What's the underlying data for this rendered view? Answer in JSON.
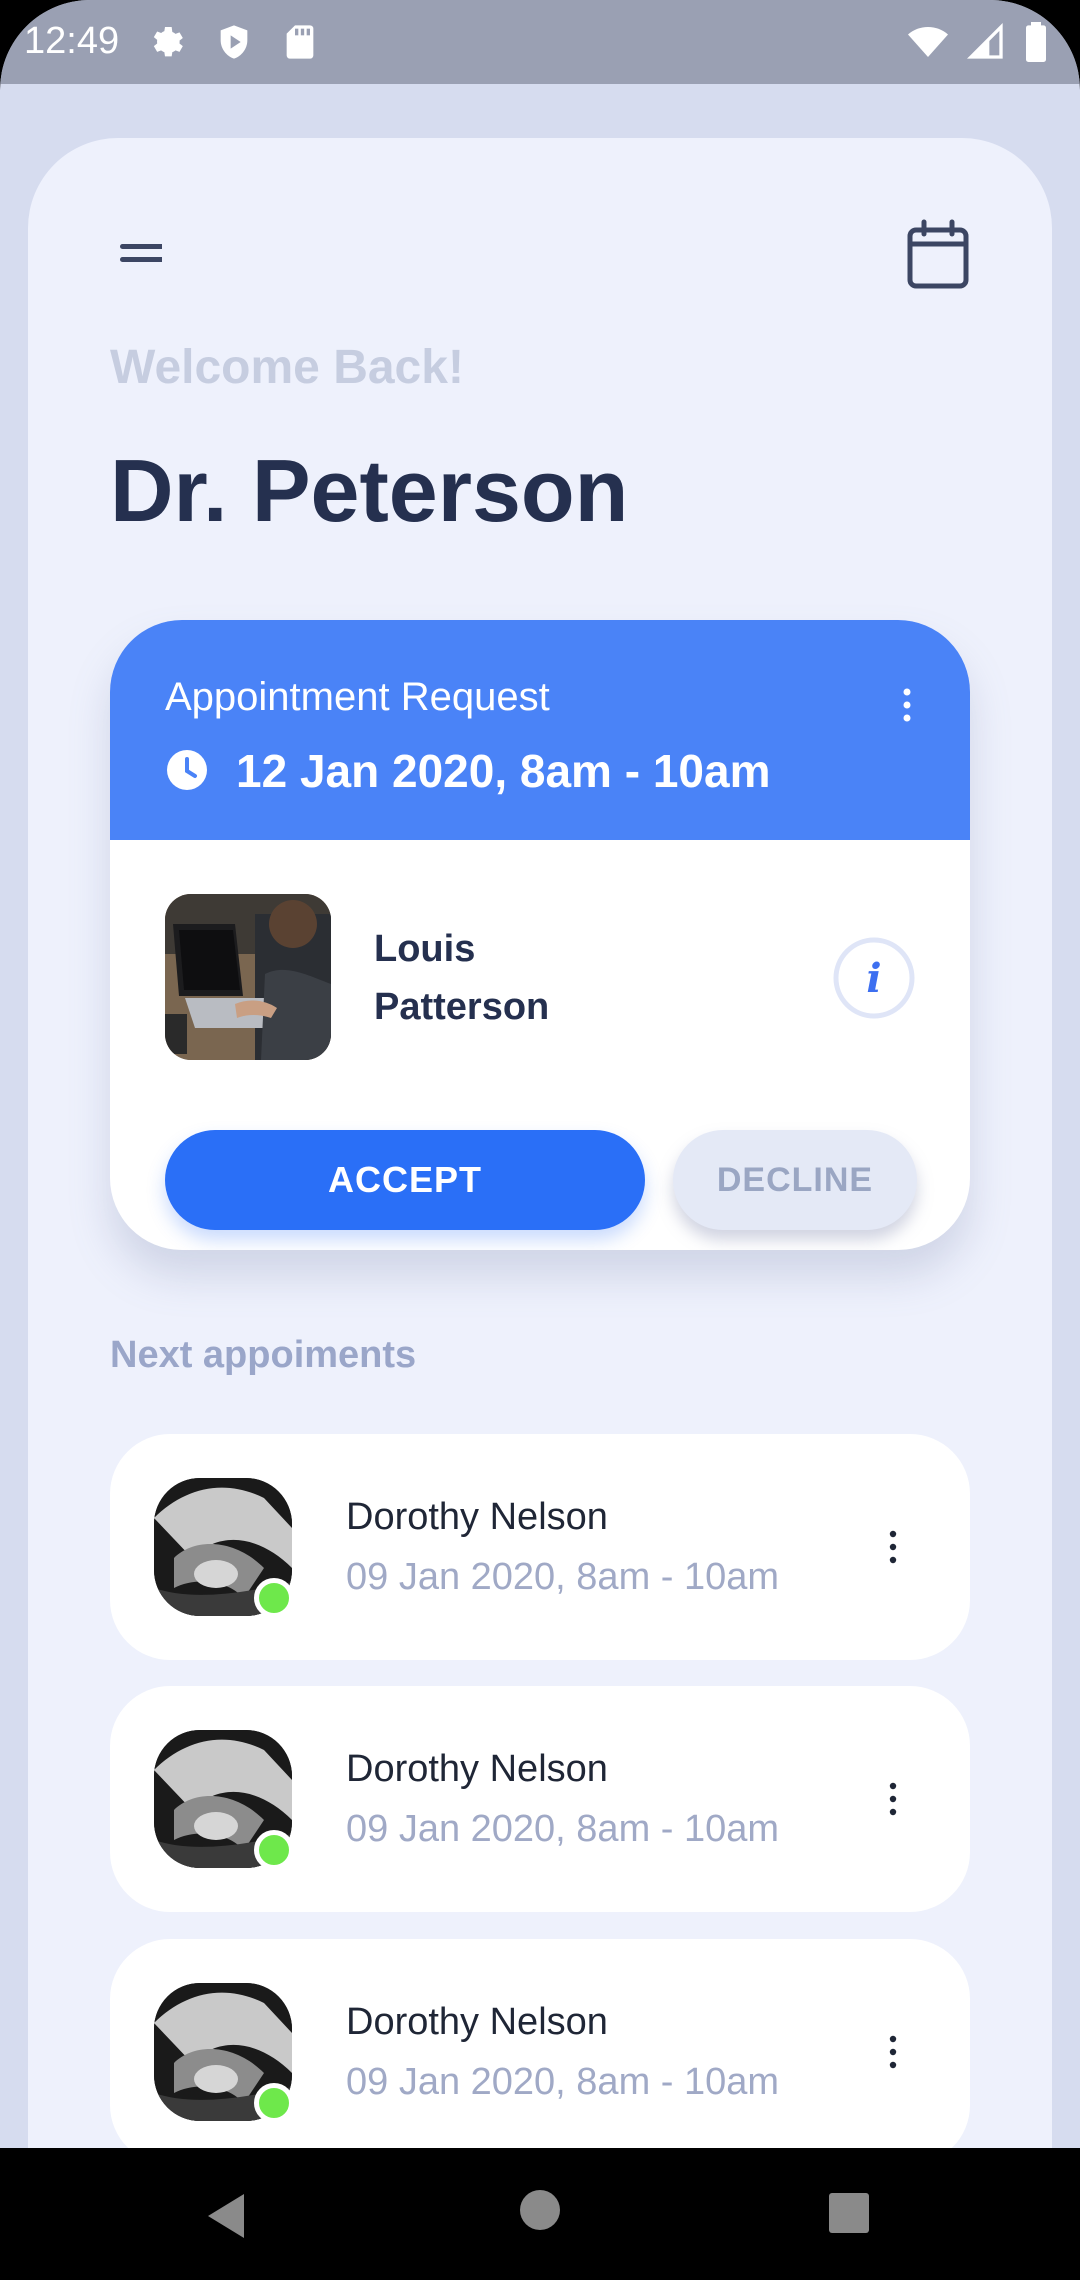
{
  "status_bar": {
    "time": "12:49",
    "left_icons": [
      "gear-icon",
      "shield-play-icon",
      "sd-card-icon"
    ],
    "right_icons": [
      "wifi-icon",
      "signal-icon",
      "battery-icon"
    ]
  },
  "header": {
    "menu_icon": "menu-icon",
    "calendar_icon": "calendar-icon",
    "welcome": "Welcome Back!",
    "doctor_name": "Dr. Peterson"
  },
  "request_card": {
    "title": "Appointment Request",
    "time": "12 Jan 2020, 8am - 10am",
    "patient_name_line1": "Louis",
    "patient_name_line2": "Patterson",
    "accept_label": "ACCEPT",
    "decline_label": "DECLINE",
    "accent_color": "#4a83f7"
  },
  "next": {
    "section_title": "Next appoiments",
    "items": [
      {
        "name": "Dorothy Nelson",
        "time": "09 Jan 2020, 8am - 10am",
        "online": true
      },
      {
        "name": "Dorothy Nelson",
        "time": "09 Jan 2020, 8am - 10am",
        "online": true
      },
      {
        "name": "Dorothy Nelson",
        "time": "09 Jan 2020, 8am - 10am",
        "online": true
      }
    ]
  },
  "nav_bar": {
    "icons": [
      "back-icon",
      "home-icon",
      "recents-icon"
    ]
  }
}
